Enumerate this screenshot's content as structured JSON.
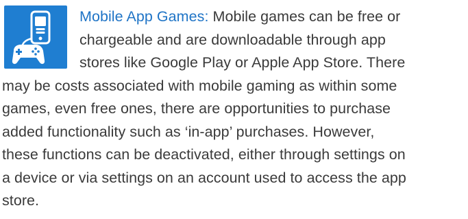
{
  "section": {
    "icon": "mobile-game-controller-icon",
    "heading": "Mobile App Games:",
    "lines": [
      " Mobile games can be free or",
      "chargeable and are downloadable through app",
      "stores like Google Play or Apple App Store. There",
      "may be costs associated with mobile gaming as within some",
      "games, even free ones, there are opportunities to purchase",
      "added functionality such as ‘in-app’ purchases. However,",
      "these functions  can be deactivated, either through settings on",
      "a device or via settings on an account used to access the app",
      "store."
    ]
  },
  "colors": {
    "accent": "#1f7ed1",
    "heading": "#1f74c6",
    "text": "#3a3a3a"
  }
}
